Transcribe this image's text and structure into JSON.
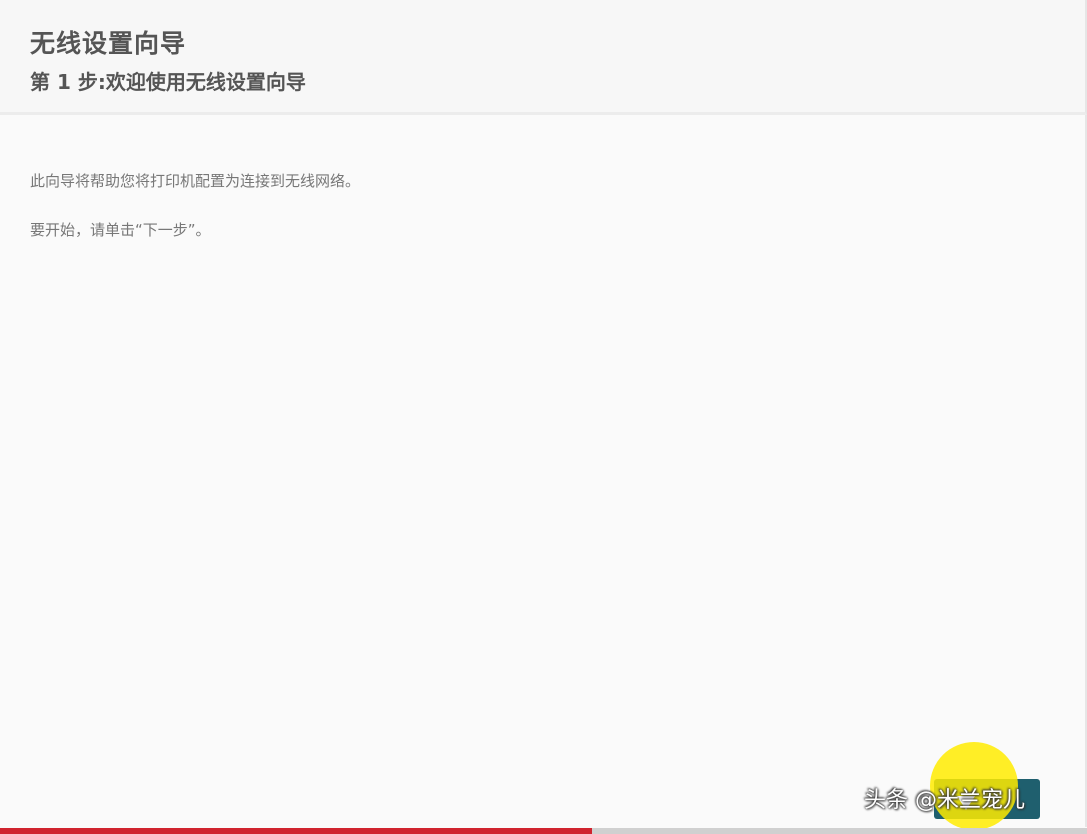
{
  "wizard": {
    "title": "无线设置向导",
    "step": "第 1 步:欢迎使用无线设置向导"
  },
  "content": {
    "line1": "此向导将帮助您将打印机配置为连接到无线网络。",
    "line2": "要开始，请单击“下一步”。"
  },
  "watermark": "头条 @米兰宠儿",
  "video_progress": 0.545,
  "colors": {
    "progress": "#d0232e",
    "button": "#1f5f6e",
    "cursor_highlight": "#ffeb00"
  }
}
